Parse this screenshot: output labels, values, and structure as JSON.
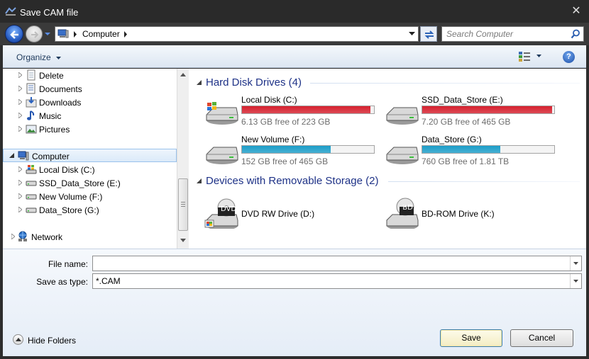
{
  "window": {
    "title": "Save CAM file",
    "close_glyph": "✕"
  },
  "navigation": {
    "address_crumb": "Computer",
    "search_placeholder": "Search Computer"
  },
  "toolbar": {
    "organize_label": "Organize",
    "help_glyph": "?"
  },
  "sidebar": {
    "items": [
      {
        "label": "Delete",
        "icon": "document-icon"
      },
      {
        "label": "Documents",
        "icon": "documents-icon"
      },
      {
        "label": "Downloads",
        "icon": "downloads-icon"
      },
      {
        "label": "Music",
        "icon": "music-icon"
      },
      {
        "label": "Pictures",
        "icon": "pictures-icon"
      },
      {
        "label": "Computer",
        "icon": "computer-icon",
        "selected": true
      },
      {
        "label": "Local Disk (C:)",
        "icon": "windows-drive-icon"
      },
      {
        "label": "SSD_Data_Store (E:)",
        "icon": "drive-icon"
      },
      {
        "label": "New Volume (F:)",
        "icon": "drive-icon"
      },
      {
        "label": "Data_Store (G:)",
        "icon": "drive-icon"
      },
      {
        "label": "Network",
        "icon": "network-icon"
      }
    ]
  },
  "groups": {
    "hard_disks": {
      "title": "Hard Disk Drives (4)",
      "drives": [
        {
          "name": "Local Disk (C:)",
          "free": "6.13 GB free of 223 GB",
          "used_fraction": 0.973,
          "bar_color": "#d6202e",
          "system": true
        },
        {
          "name": "SSD_Data_Store (E:)",
          "free": "7.20 GB free of 465 GB",
          "used_fraction": 0.985,
          "bar_color": "#d6202e",
          "system": false
        },
        {
          "name": "New Volume (F:)",
          "free": "152 GB free of 465 GB",
          "used_fraction": 0.673,
          "bar_color": "#1c9ec9",
          "system": false
        },
        {
          "name": "Data_Store (G:)",
          "free": "760 GB free of 1.81 TB",
          "used_fraction": 0.59,
          "bar_color": "#1c9ec9",
          "system": false
        }
      ]
    },
    "removable": {
      "title": "Devices with Removable Storage (2)",
      "devices": [
        {
          "name": "DVD RW Drive (D:)",
          "badge": "DVD"
        },
        {
          "name": "BD-ROM Drive (K:)",
          "badge": "BD"
        }
      ]
    }
  },
  "form": {
    "filename_label": "File name:",
    "filename_value": "",
    "type_label": "Save as type:",
    "type_value": "*.CAM",
    "hide_folders_label": "Hide Folders",
    "save_label": "Save",
    "cancel_label": "Cancel"
  }
}
